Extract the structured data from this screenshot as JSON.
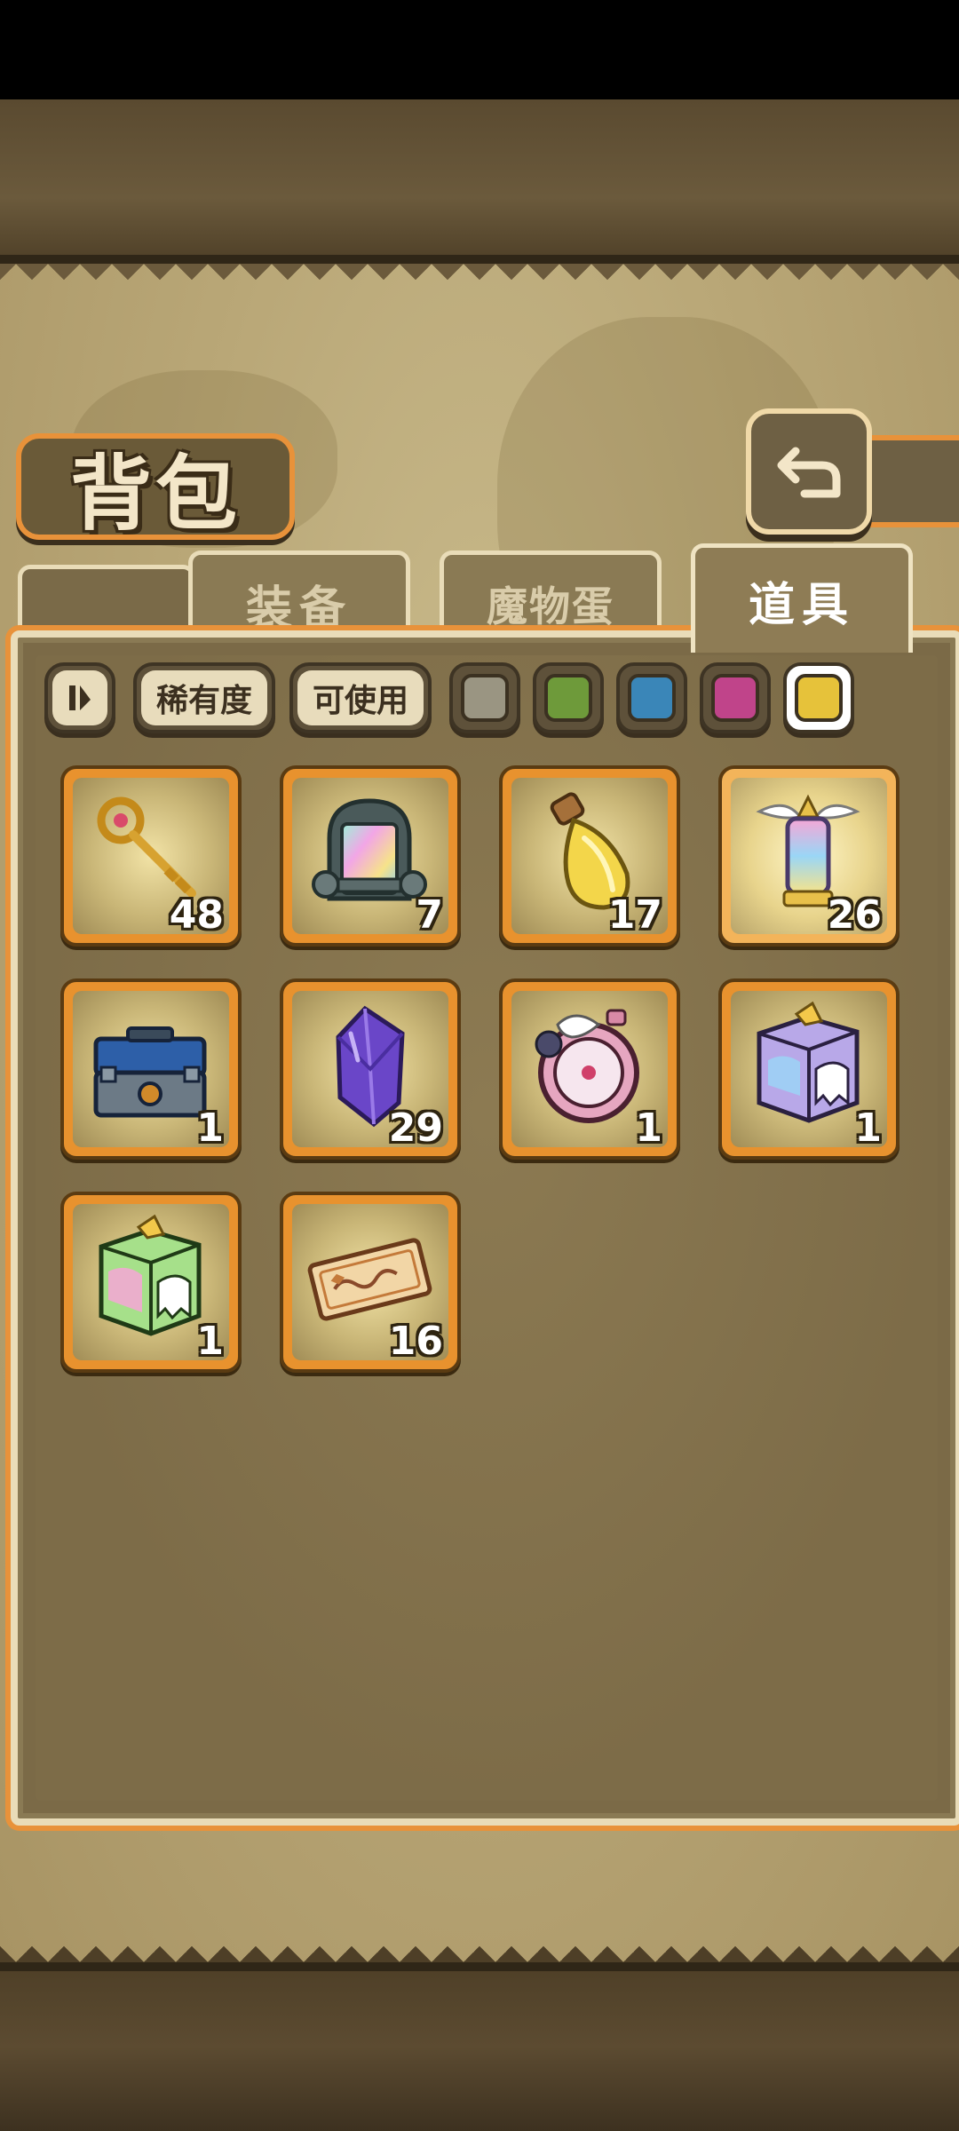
{
  "page": {
    "title": "背包"
  },
  "tabs": [
    {
      "label": "装备",
      "active": false
    },
    {
      "label": "魔物蛋",
      "active": false
    },
    {
      "label": "道具",
      "active": true
    }
  ],
  "filters": {
    "rarity_label": "稀有度",
    "usable_label": "可使用",
    "color_swatches": [
      "#9a9582",
      "#6e9a3a",
      "#3a86b8",
      "#c0448a",
      "#e6c23a"
    ],
    "selected_swatch": 4
  },
  "items": [
    {
      "name": "golden-key",
      "icon": "key-icon",
      "qty": "48"
    },
    {
      "name": "rainbow-capsule",
      "icon": "capsule-icon",
      "qty": "7"
    },
    {
      "name": "yellow-potion",
      "icon": "potion-icon",
      "qty": "17"
    },
    {
      "name": "winged-lantern",
      "icon": "lantern-icon",
      "qty": "26"
    },
    {
      "name": "toolbox",
      "icon": "toolbox-icon",
      "qty": "1"
    },
    {
      "name": "purple-crystal",
      "icon": "crystal-icon",
      "qty": "29"
    },
    {
      "name": "pocket-watch",
      "icon": "watch-icon",
      "qty": "1"
    },
    {
      "name": "ghost-box-purple",
      "icon": "ghost-box-icon",
      "qty": "1"
    },
    {
      "name": "ghost-box-green",
      "icon": "ghost-box-icon",
      "qty": "1"
    },
    {
      "name": "ticket",
      "icon": "ticket-icon",
      "qty": "16"
    }
  ],
  "colors": {
    "slot_border": "#e8922e",
    "accent_orange": "#e8923a",
    "panel": "#7b6a47"
  }
}
